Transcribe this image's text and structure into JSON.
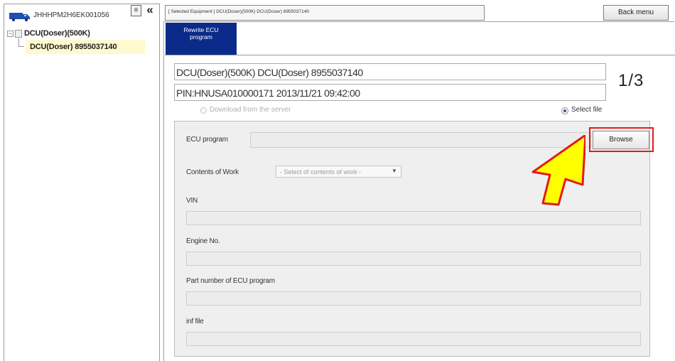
{
  "left_panel": {
    "vehicle_id": "JHHHPM2H6EK001056",
    "collapse_glyph": "≡",
    "hide_glyph": "«",
    "tree": {
      "expander_glyph": "−",
      "node_label": "DCU(Doser)(500K)",
      "child_label": "DCU(Doser) 8955037140"
    }
  },
  "header": {
    "selected_equipment": "[ Selected Equipment ] DCU(Doser)(500K) DCU(Doser) 8955037140",
    "back_menu_label": "Back menu",
    "tab_line1": "Rewrite ECU",
    "tab_line2": "program"
  },
  "main": {
    "ecu_name": "DCU(Doser)(500K) DCU(Doser) 8955037140",
    "pin_line": "PIN:HNUSA010000171 2013/11/21 09:42:00",
    "page_indicator": "1/3",
    "download_label": "Download from the server",
    "select_file_label": "Select file",
    "selected_source": "select_file",
    "form": {
      "ecu_program_label": "ECU program",
      "ecu_program_value": "",
      "browse_label": "Browse",
      "contents_label": "Contents of Work",
      "contents_selected": "- Select of contents of work -",
      "vin_label": "VIN",
      "vin_value": "",
      "engine_label": "Engine No.",
      "engine_value": "",
      "part_label": "Part number of ECU program",
      "part_value": "",
      "inf_label": "inf file",
      "inf_value": ""
    }
  },
  "colors": {
    "tab_background": "#0b2b8a",
    "highlight_border": "#e21b1b",
    "arrow_fill": "#ffff00",
    "tree_selected": "#fff9cf"
  },
  "icons": {
    "vehicle": "truck-icon",
    "pointer": "arrow-pointer-icon"
  }
}
